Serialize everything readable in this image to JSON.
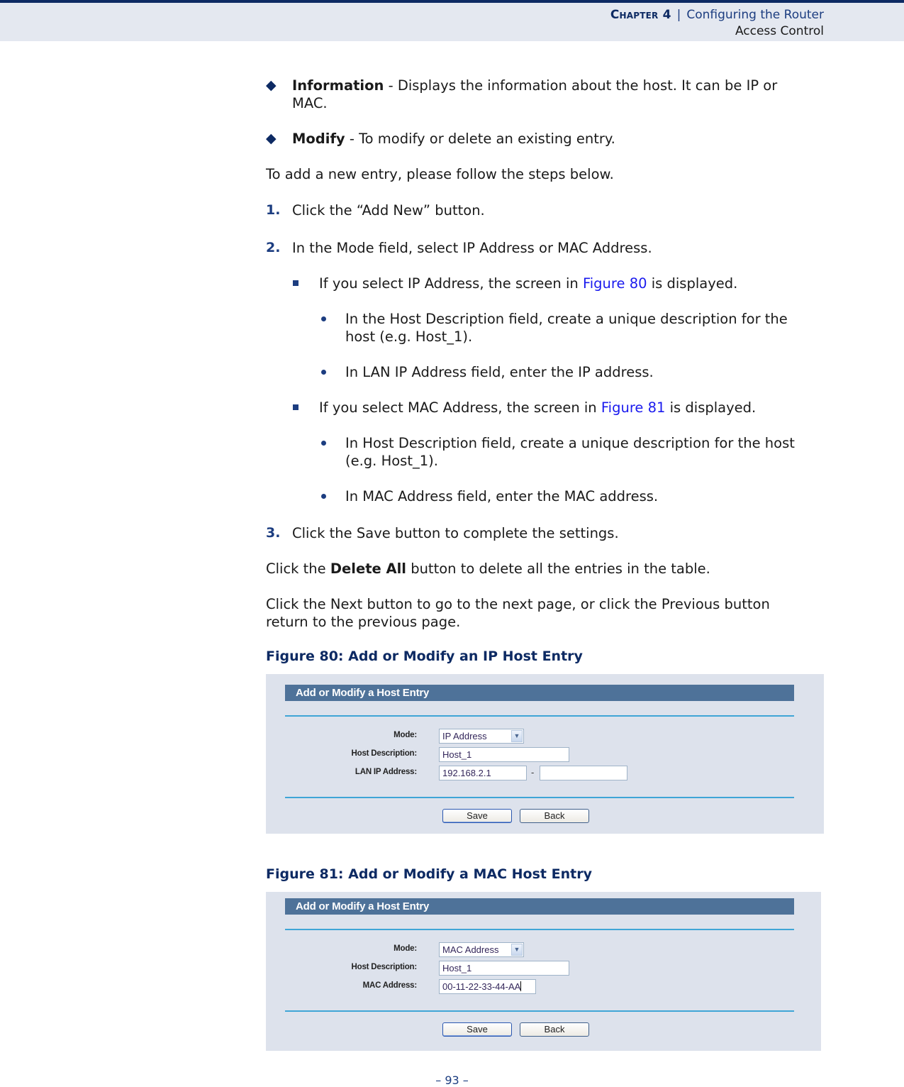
{
  "header": {
    "chapter": "Chapter 4",
    "separator": "|",
    "chapter_title": "Configuring the Router",
    "section": "Access Control"
  },
  "body": {
    "bullets": [
      {
        "term": "Information",
        "text": " - Displays the information about the host. It can be IP or",
        "text_cont": "MAC."
      },
      {
        "term": "Modify",
        "text": " - To modify or delete an existing entry."
      }
    ],
    "intro": "To add a new entry, please follow the steps below.",
    "steps": [
      {
        "num": "1.",
        "text": "Click the “Add New” button."
      },
      {
        "num": "2.",
        "text": "In the Mode field, select IP Address or MAC Address."
      },
      {
        "num": "3.",
        "text": "Click the Save button to complete the settings."
      }
    ],
    "sub_ip": {
      "pre": "If you select IP Address, the screen in ",
      "link": "Figure 80",
      "post": " is displayed.",
      "items": [
        {
          "line1": "In the Host Description field, create a unique description for the",
          "line2": "host (e.g. Host_1)."
        },
        {
          "line1": "In LAN IP Address field, enter the IP address."
        }
      ]
    },
    "sub_mac": {
      "pre": "If you select MAC Address, the screen in ",
      "link": "Figure 81",
      "post": " is displayed.",
      "items": [
        {
          "line1": "In Host Description field, create a unique description for the host",
          "line2": "(e.g. Host_1)."
        },
        {
          "line1": "In MAC Address field, enter the MAC address."
        }
      ]
    },
    "delete_all": {
      "pre": "Click the ",
      "term": "Delete All",
      "post": " button to delete all the entries in the table."
    },
    "next_prev": {
      "line1": "Click the Next button to go to the next page, or click the Previous button",
      "line2": "return to the previous page."
    }
  },
  "figures": [
    {
      "caption": "Figure 80:  Add or Modify an IP Host Entry",
      "panel_title": "Add or Modify a Host Entry",
      "mode_label": "Mode:",
      "mode_value": "IP Address",
      "host_label": "Host Description:",
      "host_value": "Host_1",
      "addr_label": "LAN IP Address:",
      "addr_value": "192.168.2.1",
      "addr_separator": "-",
      "addr_value_end": "",
      "save_label": "Save",
      "back_label": "Back"
    },
    {
      "caption": "Figure 81:  Add or Modify a MAC Host Entry",
      "panel_title": "Add or Modify a Host Entry",
      "mode_label": "Mode:",
      "mode_value": "MAC Address",
      "host_label": "Host Description:",
      "host_value": "Host_1",
      "addr_label": "MAC Address:",
      "addr_value": "00-11-22-33-44-AA",
      "save_label": "Save",
      "back_label": "Back"
    }
  ],
  "footer": {
    "page": "–  93  –"
  },
  "colors": {
    "brand_navy": "#0d2a63",
    "link_blue": "#1a1aee",
    "panel_bg": "#dde2ec",
    "panel_header": "#4e7299",
    "rule_blue": "#3fa5d6"
  }
}
